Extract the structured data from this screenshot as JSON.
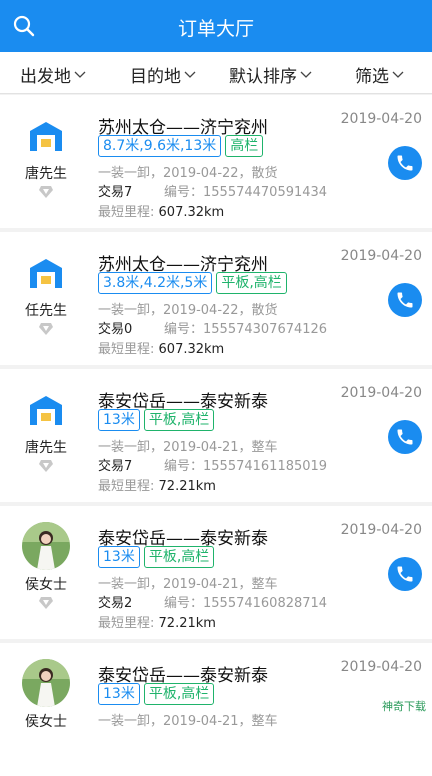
{
  "header": {
    "title": "订单大厅"
  },
  "filters": [
    {
      "label": "出发地"
    },
    {
      "label": "目的地"
    },
    {
      "label": "默认排序"
    },
    {
      "label": "筛选"
    }
  ],
  "orders": [
    {
      "name": "唐先生",
      "avatar": "warehouse-icon",
      "route": "苏州太仓——济宁兖州",
      "date": "2019-04-20",
      "length_tag": "8.7米,9.6米,13米",
      "type_tag": "高栏",
      "info1": "一装一卸，2019-04-22，散货",
      "deal": "交易7",
      "code": "编号：155574470591434",
      "distance_label": "最短里程:",
      "distance": "607.32km"
    },
    {
      "name": "任先生",
      "avatar": "warehouse-icon",
      "route": "苏州太仓——济宁兖州",
      "date": "2019-04-20",
      "length_tag": "3.8米,4.2米,5米",
      "type_tag": "平板,高栏",
      "info1": "一装一卸，2019-04-22，散货",
      "deal": "交易0",
      "code": "编号：155574307674126",
      "distance_label": "最短里程:",
      "distance": "607.32km"
    },
    {
      "name": "唐先生",
      "avatar": "warehouse-icon",
      "route": "泰安岱岳——泰安新泰",
      "date": "2019-04-20",
      "length_tag": "13米",
      "type_tag": "平板,高栏",
      "info1": "一装一卸，2019-04-21，整车",
      "deal": "交易7",
      "code": "编号：155574161185019",
      "distance_label": "最短里程:",
      "distance": "72.21km"
    },
    {
      "name": "侯女士",
      "avatar": "user-photo",
      "route": "泰安岱岳——泰安新泰",
      "date": "2019-04-20",
      "length_tag": "13米",
      "type_tag": "平板,高栏",
      "info1": "一装一卸，2019-04-21，整车",
      "deal": "交易2",
      "code": "编号：155574160828714",
      "distance_label": "最短里程:",
      "distance": "72.21km"
    },
    {
      "name": "侯女士",
      "avatar": "user-photo",
      "route": "泰安岱岳——泰安新泰",
      "date": "2019-04-20",
      "length_tag": "13米",
      "type_tag": "平板,高栏",
      "info1": "一装一卸，2019-04-21，整车",
      "deal": "",
      "code": "",
      "distance_label": "",
      "distance": ""
    }
  ],
  "watermark": "神奇下载",
  "colors": {
    "primary": "#1a8cf0",
    "green": "#1fb36b"
  }
}
